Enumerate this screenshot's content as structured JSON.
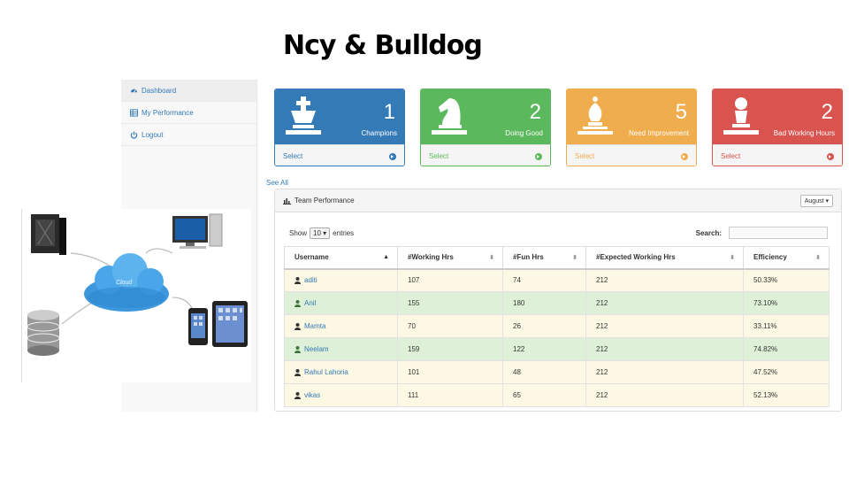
{
  "page_title": "Ncy & Bulldog",
  "sidebar": {
    "items": [
      {
        "label": "Dashboard",
        "icon": "dashboard-icon",
        "active": true
      },
      {
        "label": "My Performance",
        "icon": "table-icon",
        "active": false
      },
      {
        "label": "Logout",
        "icon": "power-icon",
        "active": false
      }
    ]
  },
  "cards": [
    {
      "count": "1",
      "label": "Champions",
      "footer": "Select",
      "color": "#337ab7",
      "icon": "chess-king-icon"
    },
    {
      "count": "2",
      "label": "Doing Good",
      "footer": "Select",
      "color": "#5cb85c",
      "icon": "chess-knight-icon"
    },
    {
      "count": "5",
      "label": "Need Improvement",
      "footer": "Select",
      "color": "#f0ad4e",
      "icon": "chess-bishop-icon"
    },
    {
      "count": "2",
      "label": "Bad Working Hours",
      "footer": "Select",
      "color": "#d9534f",
      "icon": "chess-pawn-icon"
    }
  ],
  "see_all": "See All",
  "panel": {
    "title": "Team Performance",
    "month": "August",
    "show_label": "Show",
    "entries_value": "10",
    "entries_label": "entries",
    "search_label": "Search:",
    "search_value": ""
  },
  "table": {
    "columns": [
      "Username",
      "#Working Hrs",
      "#Fun Hrs",
      "#Expected Working Hrs",
      "Efficiency"
    ],
    "rows": [
      {
        "username": "aditi",
        "working": "107",
        "fun": "74",
        "expected": "212",
        "efficiency": "50.33%",
        "status": "warning"
      },
      {
        "username": "Anil",
        "working": "155",
        "fun": "180",
        "expected": "212",
        "efficiency": "73.10%",
        "status": "success"
      },
      {
        "username": "Mamta",
        "working": "70",
        "fun": "26",
        "expected": "212",
        "efficiency": "33.11%",
        "status": "warning"
      },
      {
        "username": "Neelam",
        "working": "159",
        "fun": "122",
        "expected": "212",
        "efficiency": "74.82%",
        "status": "success"
      },
      {
        "username": "Rahul Lahoria",
        "working": "101",
        "fun": "48",
        "expected": "212",
        "efficiency": "47.52%",
        "status": "warning"
      },
      {
        "username": "vikas",
        "working": "111",
        "fun": "65",
        "expected": "212",
        "efficiency": "52.13%",
        "status": "warning"
      }
    ]
  },
  "illustration": {
    "cloud_label": "Cloud"
  }
}
